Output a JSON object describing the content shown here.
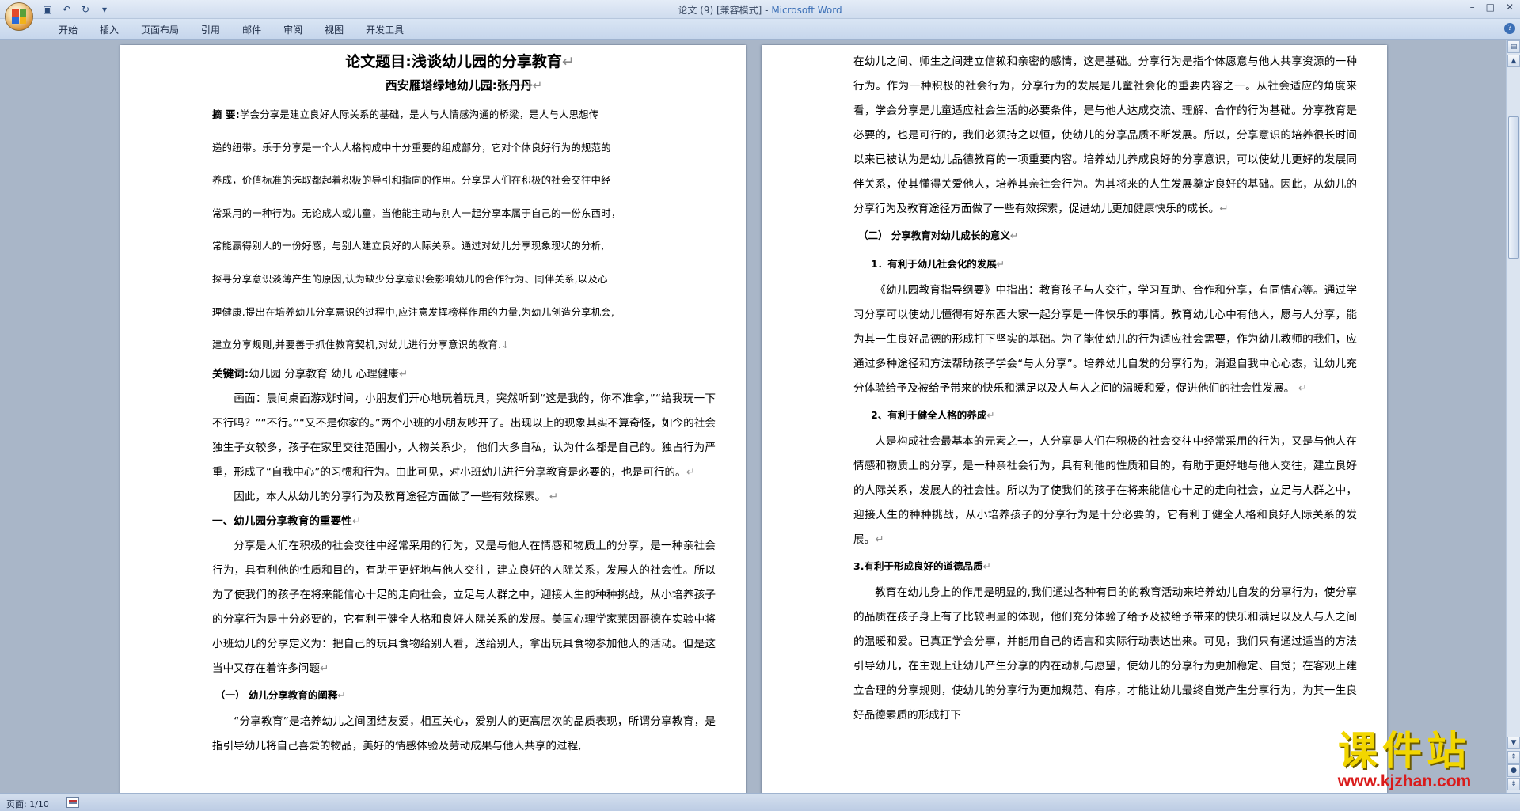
{
  "window": {
    "title_doc": "论文 (9) [兼容模式] - ",
    "title_app": "Microsoft Word",
    "minimize": "–",
    "maximize": "□",
    "close": "✕"
  },
  "ribbon": {
    "tabs": [
      "开始",
      "插入",
      "页面布局",
      "引用",
      "邮件",
      "审阅",
      "视图",
      "开发工具"
    ]
  },
  "page1": {
    "title": "论文题目:浅谈幼儿园的分享教育",
    "subtitle": "西安雁塔绿地幼儿园:张丹丹",
    "abstract_label": "摘  要:",
    "abstract_lines": [
      "学会分享是建立良好人际关系的基础，是人与人情感沟通的桥梁，是人与人思想传",
      "递的纽带。乐于分享是一个人人格构成中十分重要的组成部分，它对个体良好行为的规范的",
      "养成，价值标准的选取都起着积极的导引和指向的作用。分享是人们在积极的社会交往中经",
      "常采用的一种行为。无论成人或儿童，当他能主动与别人一起分享本属于自己的一份东西时，",
      "常能赢得别人的一份好感，与别人建立良好的人际关系。通过对幼儿分享现象现状的分析,",
      "探寻分享意识淡薄产生的原因,认为缺少分享意识会影响幼儿的合作行为、同伴关系,以及心",
      "理健康.提出在培养幼儿分享意识的过程中,应注意发挥榜样作用的力量,为幼儿创造分享机会,",
      "建立分享规则,并要善于抓住教育契机,对幼儿进行分享意识的教育."
    ],
    "keywords_label": "关键词:",
    "keywords": "幼儿园   分享教育     幼儿     心理健康",
    "para1": "画面：晨间桌面游戏时间，小朋友们开心地玩着玩具，突然听到“这是我的，你不准拿，”“给我玩一下不行吗？”“不行。”“又不是你家的。”两个小班的小朋友吵开了。出现以上的现象其实不算奇怪，如今的社会独生子女较多，孩子在家里交往范围小，人物关系少，  他们大多自私，认为什么都是自己的。独占行为严重，形成了“自我中心”的习惯和行为。由此可见，对小班幼儿进行分享教育是必要的，也是可行的。",
    "para2": "因此，本人从幼儿的分享行为及教育途径方面做了一些有效探索。",
    "heading1": "一、幼儿园分享教育的重要性",
    "para3": "分享是人们在积极的社会交往中经常采用的行为，又是与他人在情感和物质上的分享，是一种亲社会行为，具有利他的性质和目的，有助于更好地与他人交往，建立良好的人际关系，发展人的社会性。所以为了使我们的孩子在将来能信心十足的走向社会，立足与人群之中，迎接人生的种种挑战，从小培养孩子的分享行为是十分必要的，它有利于健全人格和良好人际关系的发展。美国心理学家莱因哥德在实验中将小班幼儿的分享定义为：把自己的玩具食物给别人看，送给别人，拿出玩具食物参加他人的活动。但是这当中又存在着许多问题",
    "heading2": "（一） 幼儿分享教育的阐释",
    "para4": "“分享教育”是培养幼儿之间团结友爱，相互关心，爱别人的更高层次的品质表现，所谓分享教育，是指引导幼儿将自己喜爱的物品，美好的情感体验及劳动成果与他人共享的过程,"
  },
  "page2": {
    "para1": "在幼儿之间、师生之间建立信赖和亲密的感情，这是基础。分享行为是指个体愿意与他人共享资源的一种行为。作为一种积极的社会行为，分享行为的发展是儿童社会化的重要内容之一。从社会适应的角度来看，学会分享是儿童适应社会生活的必要条件，是与他人达成交流、理解、合作的行为基础。分享教育是必要的，也是可行的，我们必须持之以恒，使幼儿的分享品质不断发展。所以，分享意识的培养很长时间以来已被认为是幼儿品德教育的一项重要内容。培养幼儿养成良好的分享意识，可以使幼儿更好的发展同伴关系，使其懂得关爱他人，培养其亲社会行为。为其将来的人生发展奠定良好的基础。因此，从幼儿的分享行为及教育途径方面做了一些有效探索，促进幼儿更加健康快乐的成长。",
    "heading_a": "（二） 分享教育对幼儿成长的意义",
    "heading_a1": "1．有利于幼儿社会化的发展",
    "para2": "《幼儿园教育指导纲要》中指出：教育孩子与人交往，学习互助、合作和分享，有同情心等。通过学习分享可以使幼儿懂得有好东西大家一起分享是一件快乐的事情。教育幼儿心中有他人，愿与人分享，能为其一生良好品德的形成打下坚实的基础。为了能使幼儿的行为适应社会需要，作为幼儿教师的我们，应通过多种途径和方法帮助孩子学会“与人分享”。培养幼儿自发的分享行为，消退自我中心心态，让幼儿充分体验给予及被给予带来的快乐和满足以及人与人之间的温暖和爱，促进他们的社会性发展。",
    "heading_a2": "2、有利于健全人格的养成",
    "para3": "人是构成社会最基本的元素之一，人分享是人们在积极的社会交往中经常采用的行为，又是与他人在情感和物质上的分享，是一种亲社会行为，具有利他的性质和目的，有助于更好地与他人交往，建立良好的人际关系，发展人的社会性。所以为了使我们的孩子在将来能信心十足的走向社会，立足与人群之中，迎接人生的种种挑战，从小培养孩子的分享行为是十分必要的，它有利于健全人格和良好人际关系的发展。",
    "heading_a3": "3.有利于形成良好的道德品质",
    "para4": "教育在幼儿身上的作用是明显的,我们通过各种有目的的教育活动来培养幼儿自发的分享行为，使分享的品质在孩子身上有了比较明显的体现，他们充分体验了给予及被给予带来的快乐和满足以及人与人之间的温暖和爱。已真正学会分享，并能用自己的语言和实际行动表达出来。可见，我们只有通过适当的方法引导幼儿，在主观上让幼儿产生分享的内在动机与愿望，使幼儿的分享行为更加稳定、自觉；在客观上建立合理的分享规则，使幼儿的分享行为更加规范、有序，才能让幼儿最终自觉产生分享行为，为其一生良好品德素质的形成打下"
  },
  "status": {
    "page": "页面: 1/10"
  },
  "watermark": {
    "main": "课件站",
    "url": "www.kjzhan.com"
  }
}
